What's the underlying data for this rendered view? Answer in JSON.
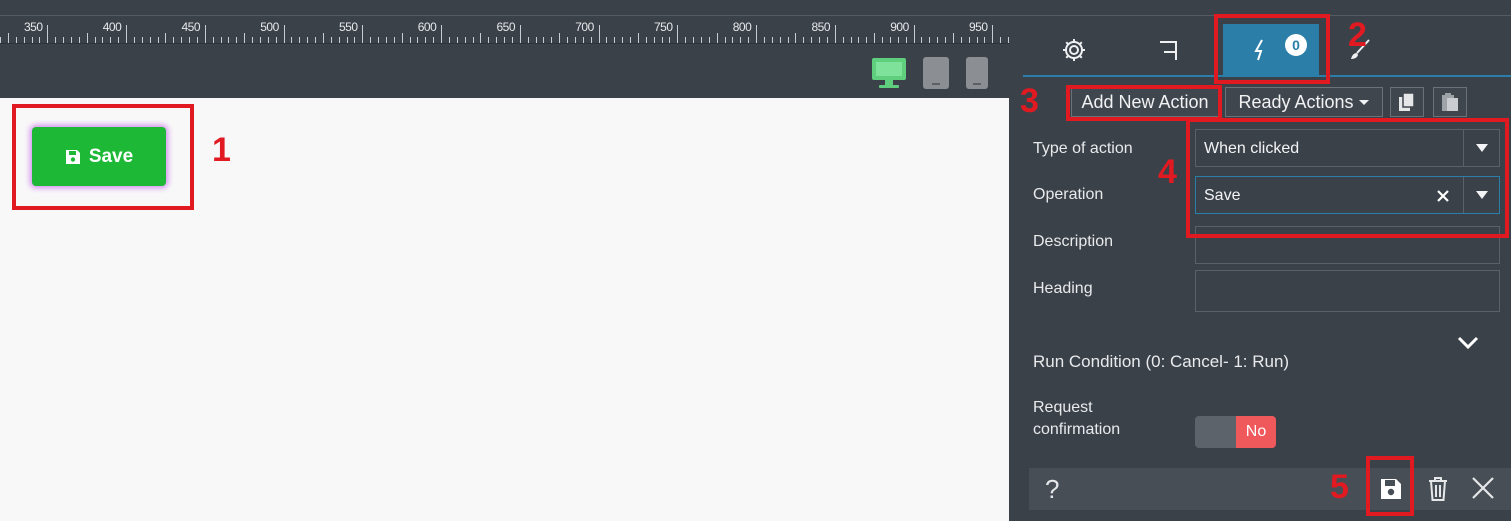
{
  "ruler": {
    "labels": [
      "350",
      "400",
      "450",
      "500",
      "550",
      "600",
      "650",
      "700",
      "750",
      "800",
      "850",
      "900",
      "950"
    ]
  },
  "canvas": {
    "save_button_label": "Save"
  },
  "panel": {
    "tabs": [
      {
        "icon": "gear-icon"
      },
      {
        "icon": "flag-icon"
      },
      {
        "icon": "lightning-icon",
        "badge": "0"
      },
      {
        "icon": "brush-icon"
      }
    ],
    "add_new_action": "Add New Action",
    "ready_actions": "Ready Actions",
    "fields": {
      "type_of_action": {
        "label": "Type of action",
        "value": "When clicked"
      },
      "operation": {
        "label": "Operation",
        "value": "Save"
      },
      "description": {
        "label": "Description",
        "value": ""
      },
      "heading": {
        "label": "Heading",
        "value": ""
      }
    },
    "run_condition": "Run Condition (0: Cancel- 1: Run)",
    "request_confirmation": {
      "line1": "Request",
      "line2": "confirmation",
      "toggle": "No"
    },
    "footer": {
      "help": "?"
    }
  },
  "annotations": [
    "1",
    "2",
    "3",
    "4",
    "5"
  ],
  "colors": {
    "accent": "#2a7ea8",
    "save_green": "#1db836",
    "annotation_red": "#e11a22",
    "toggle_no": "#f0595c"
  }
}
